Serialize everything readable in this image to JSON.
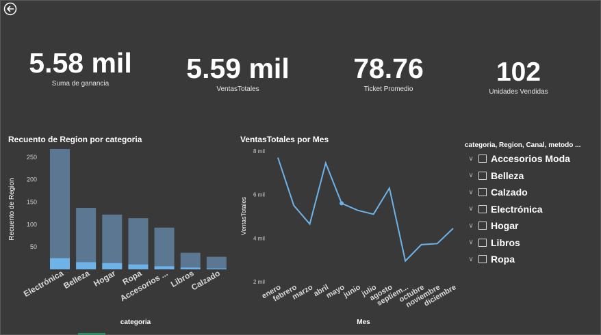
{
  "kpis": [
    {
      "value": "5.58 mil",
      "label": "Suma de ganancia"
    },
    {
      "value": "5.59 mil",
      "label": "VentasTotales"
    },
    {
      "value": "78.76",
      "label": "Ticket Promedio"
    },
    {
      "value": "102",
      "label": "Unidades Vendidas"
    }
  ],
  "bar_chart": {
    "title": "Recuento de Region por categoria",
    "xlabel": "categoria",
    "ylabel": "Recuento de Region",
    "colors": {
      "total": "#5c7791",
      "highlight": "#6eb3e8"
    }
  },
  "line_chart": {
    "title": "VentasTotales por Mes",
    "xlabel": "Mes",
    "ylabel": "VentasTotales",
    "color": "#6eb3e8"
  },
  "slicer": {
    "title": "categoria, Region, Canal, metodo ...",
    "items": [
      "Accesorios Moda",
      "Belleza",
      "Calzado",
      "Electrónica",
      "Hogar",
      "Libros",
      "Ropa"
    ]
  },
  "chart_data": [
    {
      "type": "bar",
      "title": "Recuento de Region por categoria",
      "xlabel": "categoria",
      "ylabel": "Recuento de Region",
      "categories": [
        "Electrónica",
        "Belleza",
        "Hogar",
        "Ropa",
        "Accesorios ...",
        "Libros",
        "Calzado"
      ],
      "series": [
        {
          "values": [
            268,
            137,
            122,
            114,
            93,
            37,
            28
          ]
        },
        {
          "values": [
            25,
            16,
            14,
            11,
            7,
            4,
            2
          ]
        }
      ],
      "ylim": [
        0,
        268
      ],
      "yticks": [
        50,
        100,
        150,
        200,
        250
      ]
    },
    {
      "type": "line",
      "title": "VentasTotales por Mes",
      "xlabel": "Mes",
      "ylabel": "VentasTotales",
      "x": [
        "enero",
        "febrero",
        "marzo",
        "abril",
        "mayo",
        "junio",
        "julio",
        "agosto",
        "septiem...",
        "octubre",
        "noviembre",
        "diciembre"
      ],
      "values": [
        7.7,
        5.5,
        4.65,
        7.45,
        5.6,
        5.28,
        5.1,
        6.3,
        2.95,
        3.7,
        3.75,
        4.45
      ],
      "ylim": [
        2,
        8
      ],
      "yticks": [
        2,
        4,
        6,
        8
      ],
      "ytick_labels": [
        "2 mil",
        "4 mil",
        "6 mil",
        "8 mil"
      ]
    }
  ]
}
